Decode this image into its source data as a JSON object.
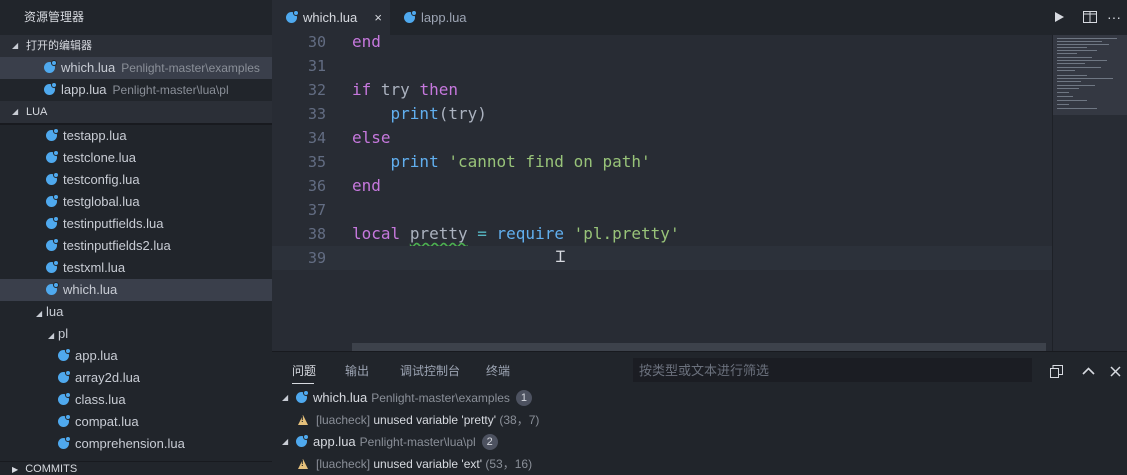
{
  "sidebar": {
    "title": "资源管理器",
    "open_editors_header": "打开的编辑器",
    "open_editors": [
      {
        "name": "which.lua",
        "path": "Penlight-master\\examples"
      },
      {
        "name": "lapp.lua",
        "path": "Penlight-master\\lua\\pl"
      }
    ],
    "lua_header": "LUA",
    "files": [
      "testapp.lua",
      "testclone.lua",
      "testconfig.lua",
      "testglobal.lua",
      "testinputfields.lua",
      "testinputfields2.lua",
      "testxml.lua",
      "which.lua"
    ],
    "folder_lua": "lua",
    "folder_pl": "pl",
    "pl_files": [
      "app.lua",
      "array2d.lua",
      "class.lua",
      "compat.lua",
      "comprehension.lua"
    ],
    "commits_header": "COMMITS"
  },
  "tabs": [
    {
      "label": "which.lua",
      "close": "×"
    },
    {
      "label": "lapp.lua"
    }
  ],
  "tab_actions": {
    "run_icon": "play-icon",
    "split_icon": "split-editor-icon",
    "more": "···"
  },
  "editor": {
    "lines": [
      {
        "n": "30",
        "tokens": [
          {
            "t": "end",
            "c": "kw"
          }
        ]
      },
      {
        "n": "31",
        "tokens": []
      },
      {
        "n": "32",
        "tokens": [
          {
            "t": "if",
            "c": "kw"
          },
          {
            "t": " try ",
            "c": ""
          },
          {
            "t": "then",
            "c": "kw"
          }
        ]
      },
      {
        "n": "33",
        "tokens": [
          {
            "t": "    ",
            "c": ""
          },
          {
            "t": "print",
            "c": "fn"
          },
          {
            "t": "(try)",
            "c": ""
          }
        ]
      },
      {
        "n": "34",
        "tokens": [
          {
            "t": "else",
            "c": "kw"
          }
        ]
      },
      {
        "n": "35",
        "tokens": [
          {
            "t": "    ",
            "c": ""
          },
          {
            "t": "print",
            "c": "fn"
          },
          {
            "t": " ",
            "c": ""
          },
          {
            "t": "'cannot find on path'",
            "c": "str"
          }
        ]
      },
      {
        "n": "36",
        "tokens": [
          {
            "t": "end",
            "c": "kw"
          }
        ]
      },
      {
        "n": "37",
        "tokens": []
      },
      {
        "n": "38",
        "tokens": [
          {
            "t": "local",
            "c": "kw"
          },
          {
            "t": " ",
            "c": ""
          },
          {
            "t": "pretty",
            "c": "squiggle"
          },
          {
            "t": " ",
            "c": ""
          },
          {
            "t": "=",
            "c": "op"
          },
          {
            "t": " ",
            "c": ""
          },
          {
            "t": "require",
            "c": "fn"
          },
          {
            "t": " ",
            "c": ""
          },
          {
            "t": "'pl.pretty'",
            "c": "str"
          }
        ]
      },
      {
        "n": "39",
        "tokens": []
      }
    ]
  },
  "panel": {
    "tabs": [
      "问题",
      "输出",
      "调试控制台",
      "终端"
    ],
    "filter_placeholder": "按类型或文本进行筛选",
    "problems": [
      {
        "file": "which.lua",
        "path": "Penlight-master\\examples",
        "count": "1",
        "items": [
          {
            "source": "[luacheck]",
            "message": "unused variable 'pretty'",
            "location": "(38，7)"
          }
        ]
      },
      {
        "file": "app.lua",
        "path": "Penlight-master\\lua\\pl",
        "count": "2",
        "items": [
          {
            "source": "[luacheck]",
            "message": "unused variable 'ext'",
            "location": "(53，16)"
          }
        ]
      }
    ]
  },
  "colors": {
    "accent": "#4fa9ee",
    "keyword": "#c678dd",
    "function": "#61afef",
    "string": "#98c379",
    "warning": "#e5c07b"
  }
}
